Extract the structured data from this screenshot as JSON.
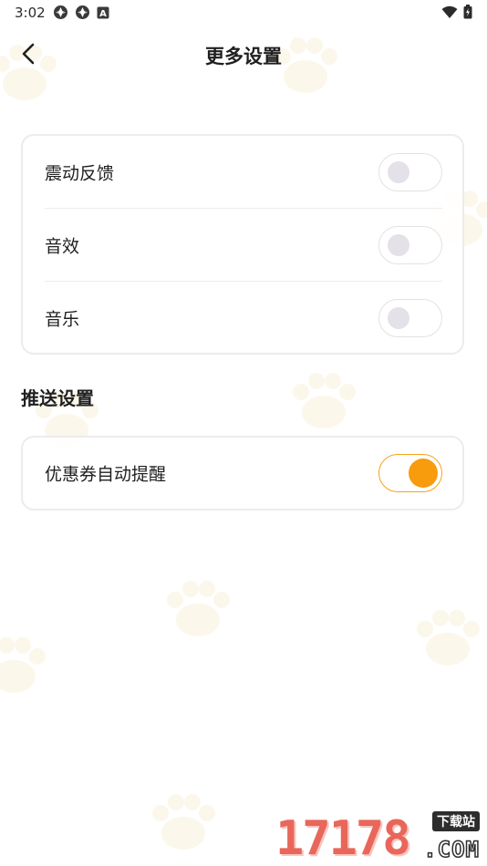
{
  "status_bar": {
    "time": "3:02",
    "left_icons": [
      "app-notification-icon",
      "app-notification-icon",
      "a-badge-icon"
    ],
    "right_icons": [
      "wifi-icon",
      "battery-icon"
    ],
    "a_badge_letter": "A"
  },
  "header": {
    "title": "更多设置",
    "back_icon": "chevron-left-icon"
  },
  "settings": {
    "items": [
      {
        "label": "震动反馈",
        "enabled": false
      },
      {
        "label": "音效",
        "enabled": false
      },
      {
        "label": "音乐",
        "enabled": false
      }
    ]
  },
  "push": {
    "section_title": "推送设置",
    "items": [
      {
        "label": "优惠券自动提醒",
        "enabled": true
      }
    ]
  },
  "colors": {
    "accent": "#f89b0c",
    "toggle_off_knob": "#e4e1e8",
    "card_border": "#ececec",
    "background_pattern": "#f6e9c9"
  },
  "watermark": {
    "digits": "17178",
    "badge": "下载站",
    "domain": ".COM"
  }
}
